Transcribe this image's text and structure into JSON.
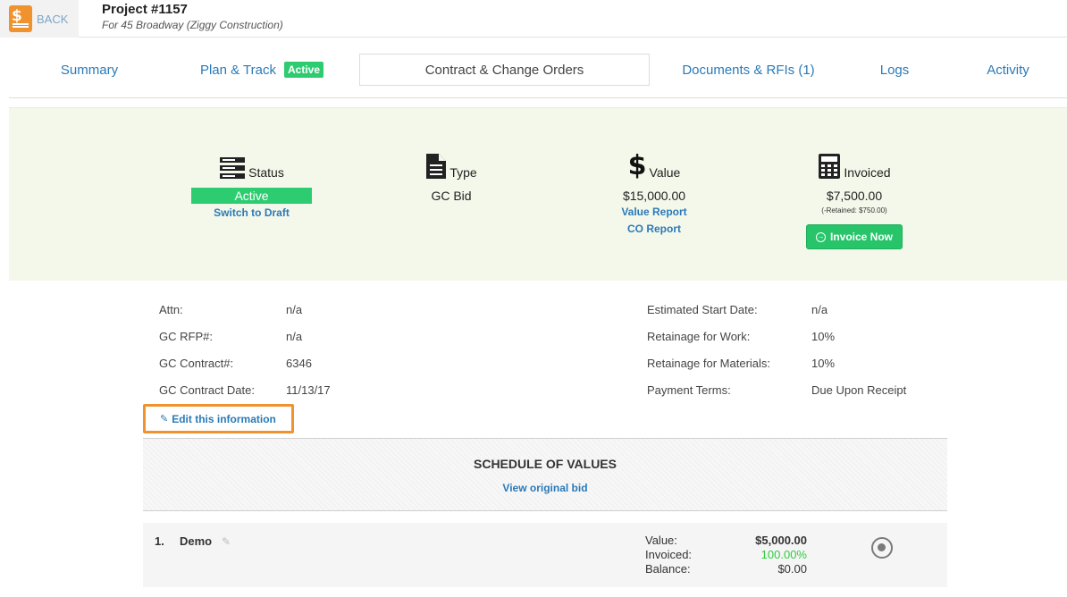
{
  "header": {
    "back_label": "BACK",
    "title": "Project #1157",
    "subtitle": "For 45 Broadway (Ziggy Construction)"
  },
  "tabs": [
    {
      "label": "Summary"
    },
    {
      "label": "Plan & Track",
      "badge": "Active"
    },
    {
      "label": "Contract & Change Orders",
      "selected": true
    },
    {
      "label": "Documents & RFIs (1)"
    },
    {
      "label": "Logs"
    },
    {
      "label": "Activity"
    }
  ],
  "summary": {
    "status": {
      "label": "Status",
      "value": "Active",
      "link": "Switch to Draft"
    },
    "type": {
      "label": "Type",
      "value": "GC Bid"
    },
    "value": {
      "label": "Value",
      "value": "$15,000.00",
      "link1": "Value Report",
      "link2": "CO Report"
    },
    "invoiced": {
      "label": "Invoiced",
      "value": "$7,500.00",
      "retained": "(-Retained: $750.00)",
      "button": "Invoice Now"
    }
  },
  "info": {
    "left": [
      {
        "label": "Attn:",
        "value": "n/a"
      },
      {
        "label": "GC RFP#:",
        "value": "n/a"
      },
      {
        "label": "GC Contract#:",
        "value": "6346"
      },
      {
        "label": "GC Contract Date:",
        "value": "11/13/17"
      }
    ],
    "right": [
      {
        "label": "Estimated Start Date:",
        "value": "n/a"
      },
      {
        "label": "Retainage for Work:",
        "value": "10%"
      },
      {
        "label": "Retainage for Materials:",
        "value": "10%"
      },
      {
        "label": "Payment Terms:",
        "value": "Due Upon Receipt"
      }
    ],
    "edit_link": "Edit this information"
  },
  "schedule": {
    "title": "SCHEDULE OF VALUES",
    "link": "View original bid",
    "items": [
      {
        "number": "1.",
        "name": "Demo",
        "value_label": "Value:",
        "value": "$5,000.00",
        "invoiced_label": "Invoiced:",
        "invoiced": "100.00%",
        "balance_label": "Balance:",
        "balance": "$0.00"
      }
    ]
  },
  "colors": {
    "link": "#2a7ab8",
    "accent_green": "#2ecc71",
    "highlight_orange": "#f0922e",
    "summary_bg": "#f4f8ea"
  }
}
